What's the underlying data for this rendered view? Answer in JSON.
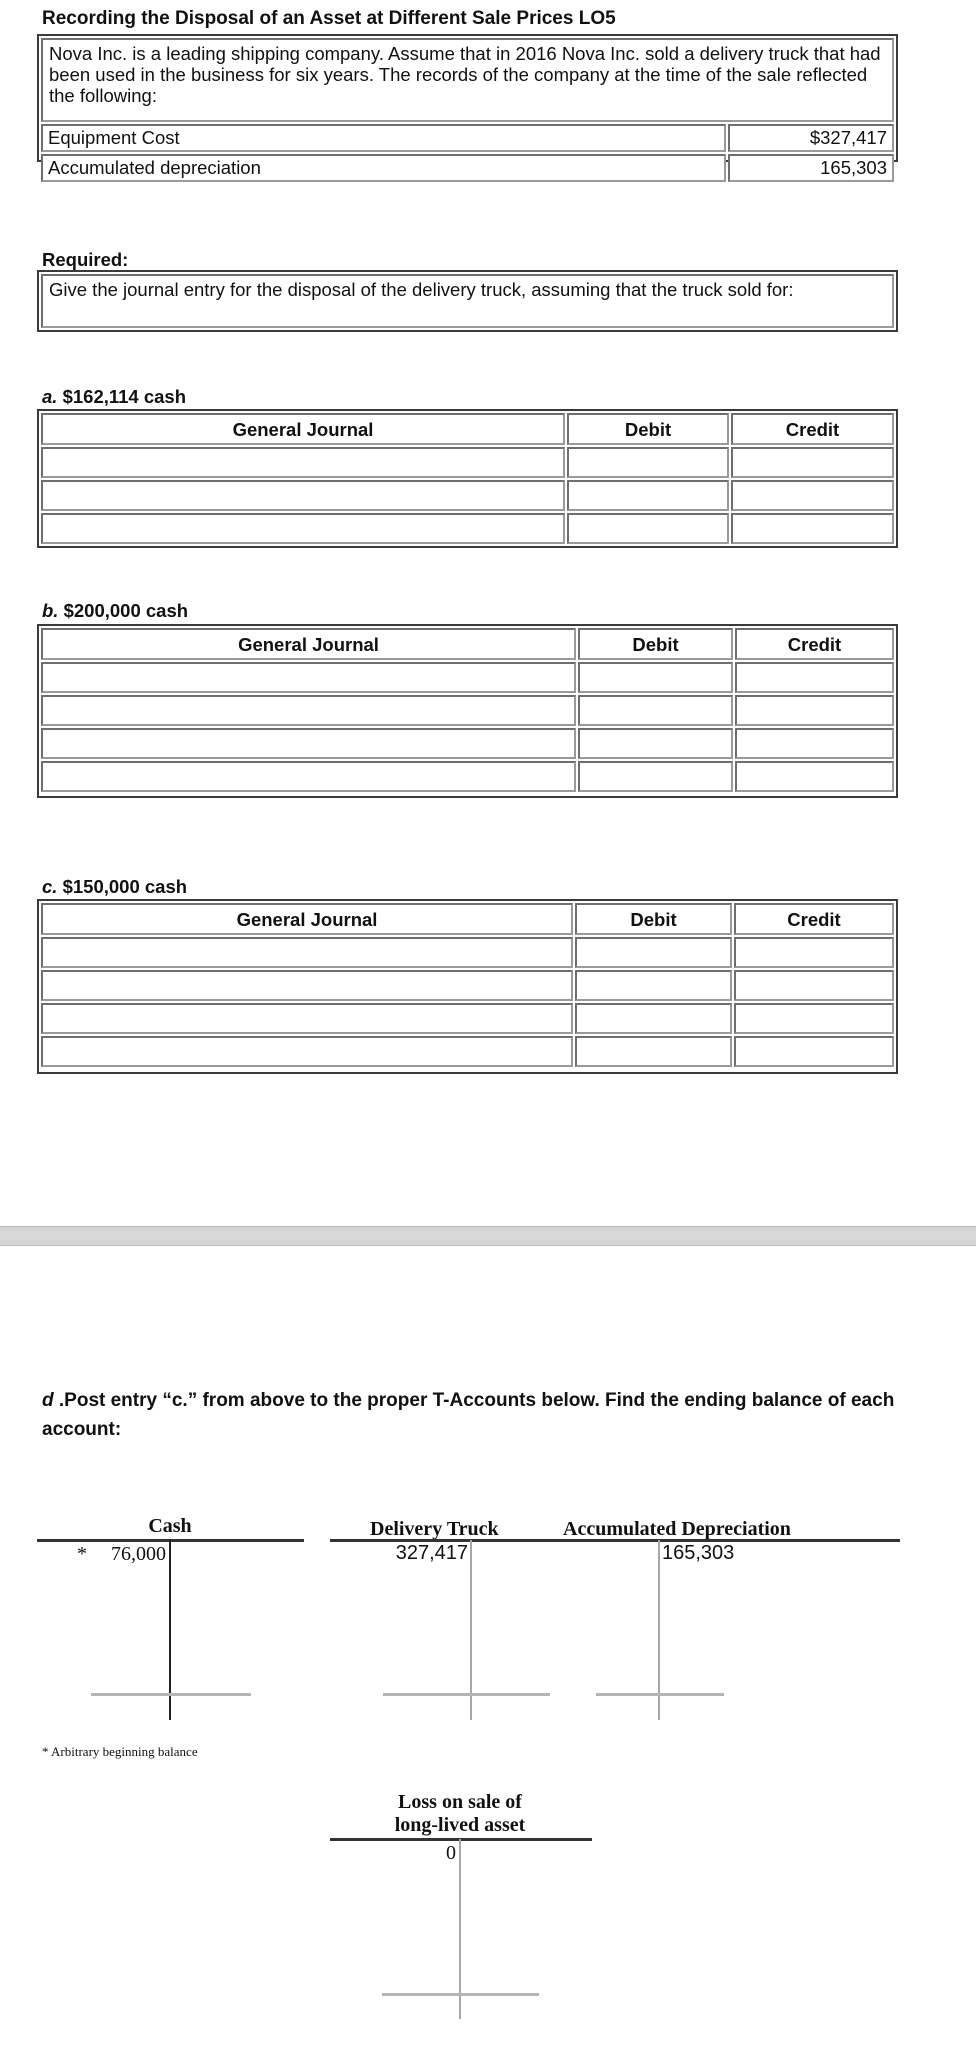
{
  "document": {
    "title": "Recording the Disposal of an Asset at Different Sale Prices LO5",
    "intro": "Nova Inc. is a leading shipping company. Assume that in 2016 Nova Inc. sold a delivery truck that had been used in the business for six years. The records of the company at the time of the sale reflected the following:",
    "facts": [
      {
        "label": "Equipment Cost",
        "value": "$327,417"
      },
      {
        "label": "Accumulated depreciation",
        "value": "165,303"
      }
    ],
    "required_label": "Required:",
    "required_text": "Give the journal entry for the disposal of the delivery truck, assuming that the truck sold for:"
  },
  "journals": [
    {
      "letter": "a.",
      "label": " $162,114 cash",
      "headers": [
        "General Journal",
        "Debit",
        "Credit"
      ],
      "rows": [
        [
          "",
          "",
          ""
        ],
        [
          "",
          "",
          ""
        ],
        [
          "",
          "",
          ""
        ]
      ]
    },
    {
      "letter": "b.",
      "label": " $200,000 cash",
      "headers": [
        "General Journal",
        "Debit",
        "Credit"
      ],
      "rows": [
        [
          "",
          "",
          ""
        ],
        [
          "",
          "",
          ""
        ],
        [
          "",
          "",
          ""
        ],
        [
          "",
          "",
          ""
        ]
      ]
    },
    {
      "letter": "c.",
      "label": " $150,000 cash",
      "headers": [
        "General Journal",
        "Debit",
        "Credit"
      ],
      "rows": [
        [
          "",
          "",
          ""
        ],
        [
          "",
          "",
          ""
        ],
        [
          "",
          "",
          ""
        ],
        [
          "",
          "",
          ""
        ]
      ]
    }
  ],
  "part_d": {
    "letter": "d",
    "text": " .Post entry “c.” from above to the proper T-Accounts below.  Find the ending balance of each account:",
    "t_accounts": [
      {
        "name": "Cash",
        "debit": "76,000",
        "credit": "",
        "marker": "*"
      },
      {
        "name": "Delivery Truck",
        "debit": "327,417",
        "credit": ""
      },
      {
        "name": "Accumulated Depreciation",
        "debit": "",
        "credit": "165,303"
      },
      {
        "name_line1": "Loss on sale of",
        "name_line2": "long-lived asset",
        "debit": "0",
        "credit": ""
      }
    ],
    "footnote": "* Arbitrary beginning balance"
  }
}
